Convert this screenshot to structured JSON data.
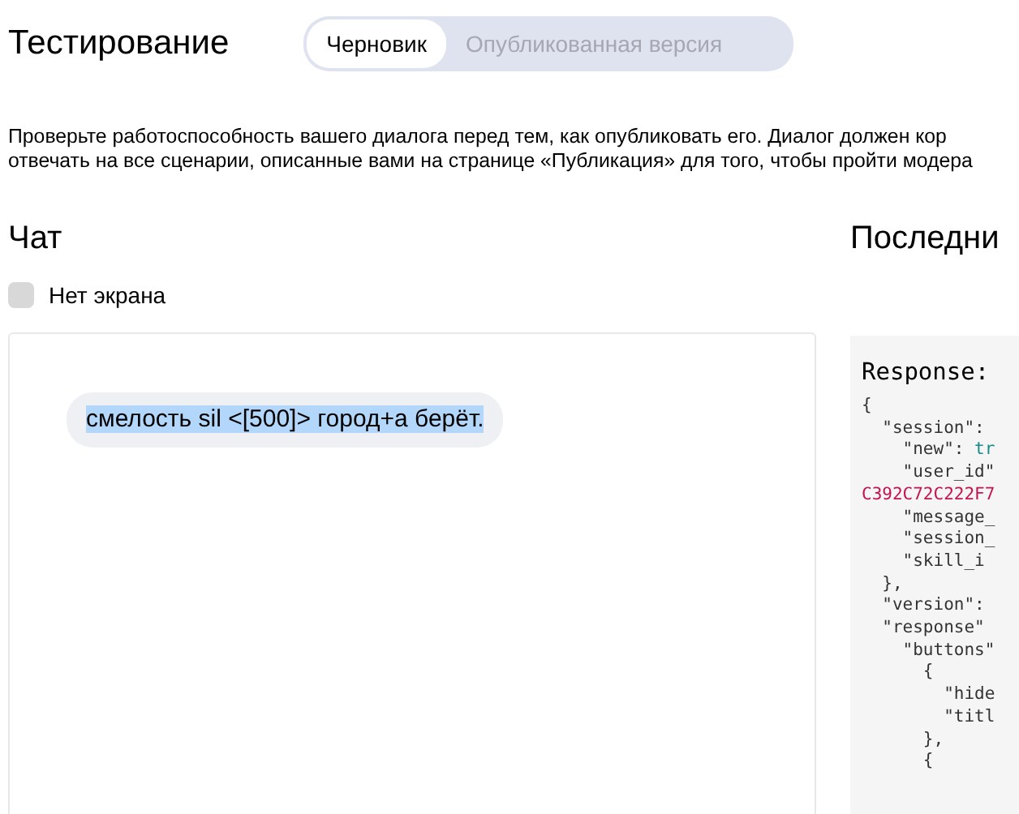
{
  "title": "Тестирование",
  "tabs": [
    {
      "label": "Черновик",
      "selected": true
    },
    {
      "label": "Опубликованная версия",
      "selected": false
    }
  ],
  "description": [
    "Проверьте работоспособность вашего диалога перед тем, как опубликовать его. Диалог должен кор",
    "отвечать на все сценарии, описанные вами на странице «Публикация» для того, чтобы пройти модера"
  ],
  "chat": {
    "heading": "Чат",
    "no_screen": {
      "label": "Нет экрана",
      "checked": false
    },
    "messages": [
      {
        "text": "смелость sil <[500]> город+а берёт.",
        "selected": true
      }
    ]
  },
  "log": {
    "heading": "Последни",
    "response_label": "Response:",
    "lines": [
      {
        "text": "{"
      },
      {
        "text": "  \"session\": "
      },
      {
        "text": "    \"new\": ",
        "value": "tr",
        "kind": "bool"
      },
      {
        "text": "    \"user_id\""
      },
      {
        "value": "C392C72C222F7",
        "kind": "string"
      },
      {
        "text": "    \"message_"
      },
      {
        "text": "    \"session_"
      },
      {
        "text": "    \"skill_i"
      },
      {
        "text": "  },"
      },
      {
        "text": "  \"version\": "
      },
      {
        "text": "  \"response\""
      },
      {
        "text": "    \"buttons\""
      },
      {
        "text": "      {"
      },
      {
        "text": "        \"hide"
      },
      {
        "text": "        \"titl"
      },
      {
        "text": "      },"
      },
      {
        "text": "      {"
      }
    ]
  }
}
